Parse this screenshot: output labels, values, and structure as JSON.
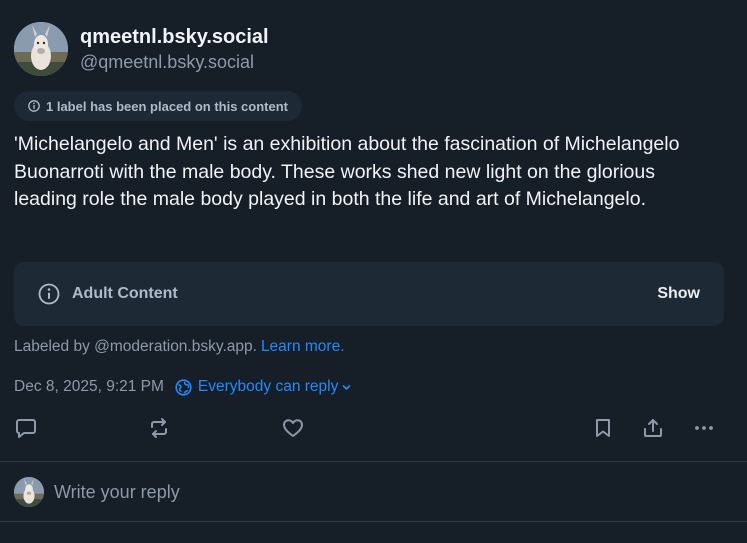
{
  "author": {
    "display_name": "qmeetnl.bsky.social",
    "handle": "@qmeetnl.bsky.social",
    "avatar": "donkey-avatar"
  },
  "label_notice": {
    "icon": "info-icon",
    "text": "1 label has been placed on this content"
  },
  "post": {
    "text": "'Michelangelo and Men' is an exhibition about the fascination of Michelangelo Buonarroti with the male body. These works shed new light on the glorious leading role the male body played in both the life and art of Michelangelo."
  },
  "content_warning": {
    "icon": "info-icon",
    "title": "Adult Content",
    "action": "Show"
  },
  "labeled_by": {
    "text": "Labeled by @moderation.bsky.app.",
    "link": "Learn more."
  },
  "meta": {
    "timestamp": "Dec 8, 2025, 9:21 PM",
    "reply_setting": "Everybody can reply",
    "reply_icon": "globe-icon"
  },
  "actions": [
    "reply-icon",
    "repost-icon",
    "like-icon",
    "bookmark-icon",
    "share-icon",
    "more-icon"
  ],
  "reply_bar": {
    "placeholder": "Write your reply"
  },
  "colors": {
    "background": "#161e27",
    "card": "#1e2936",
    "accent": "#208bfe",
    "muted_text": "#8c9aaa",
    "text": "#f1f3f5"
  }
}
